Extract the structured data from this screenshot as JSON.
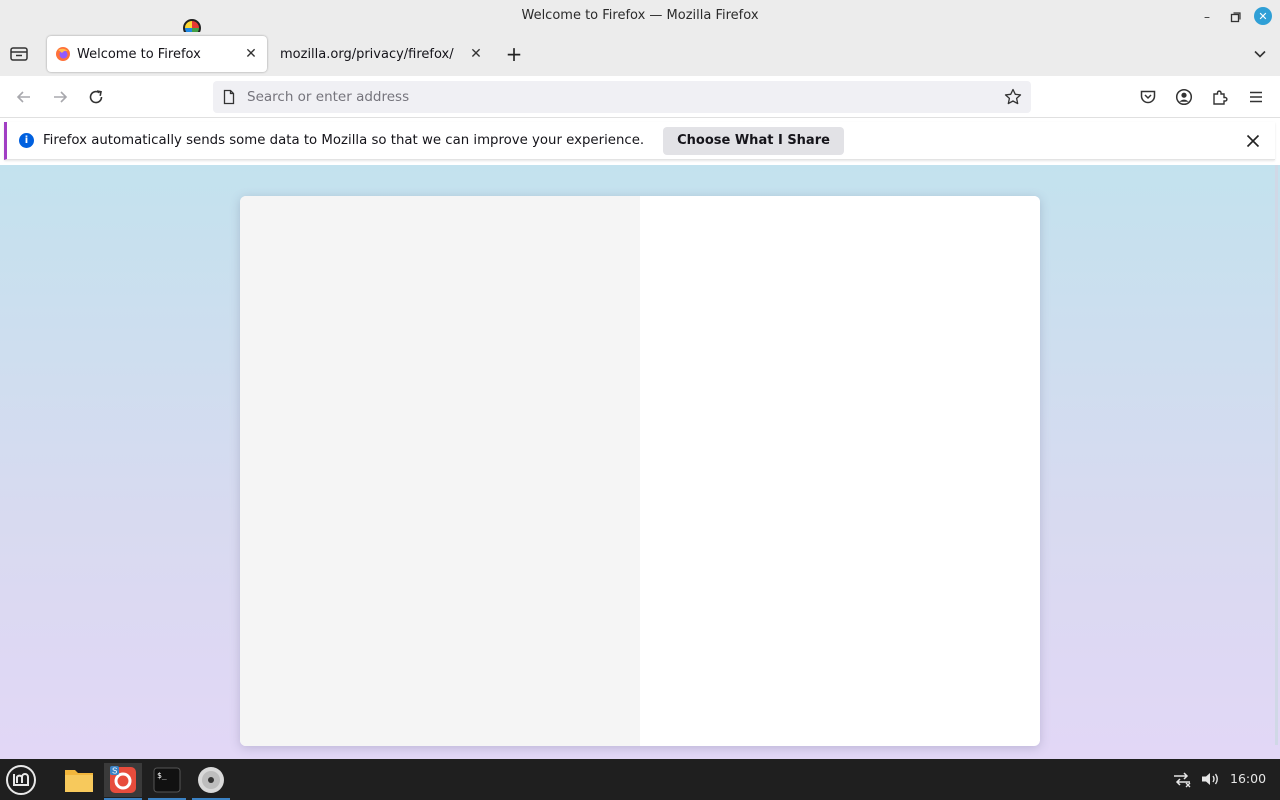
{
  "window": {
    "title": "Welcome to Firefox — Mozilla Firefox",
    "minimize_glyph": "–",
    "maximize_glyph": "□",
    "close_glyph": "✕"
  },
  "tabs": [
    {
      "label": "Welcome to Firefox",
      "active": true,
      "icon": "firefox-icon"
    },
    {
      "label": "mozilla.org/privacy/firefox/",
      "active": false
    }
  ],
  "tab_close_glyph": "✕",
  "new_tab_glyph": "+",
  "urlbar": {
    "placeholder": "Search or enter address",
    "value": ""
  },
  "notification": {
    "message": "Firefox automatically sends some data to Mozilla so that we can improve your experience.",
    "button_label": "Choose What I Share",
    "info_glyph": "i"
  },
  "taskbar": {
    "clock": "16:00",
    "apps": [
      "menu-icon",
      "files-icon",
      "app-icon",
      "terminal-icon",
      "disc-icon"
    ],
    "terminal_glyph": "$_"
  },
  "colors": {
    "accent": "#a13fc4",
    "info_blue": "#0060df",
    "wm_close": "#2f9fd6",
    "taskbar_bg": "#1f1f1f"
  }
}
